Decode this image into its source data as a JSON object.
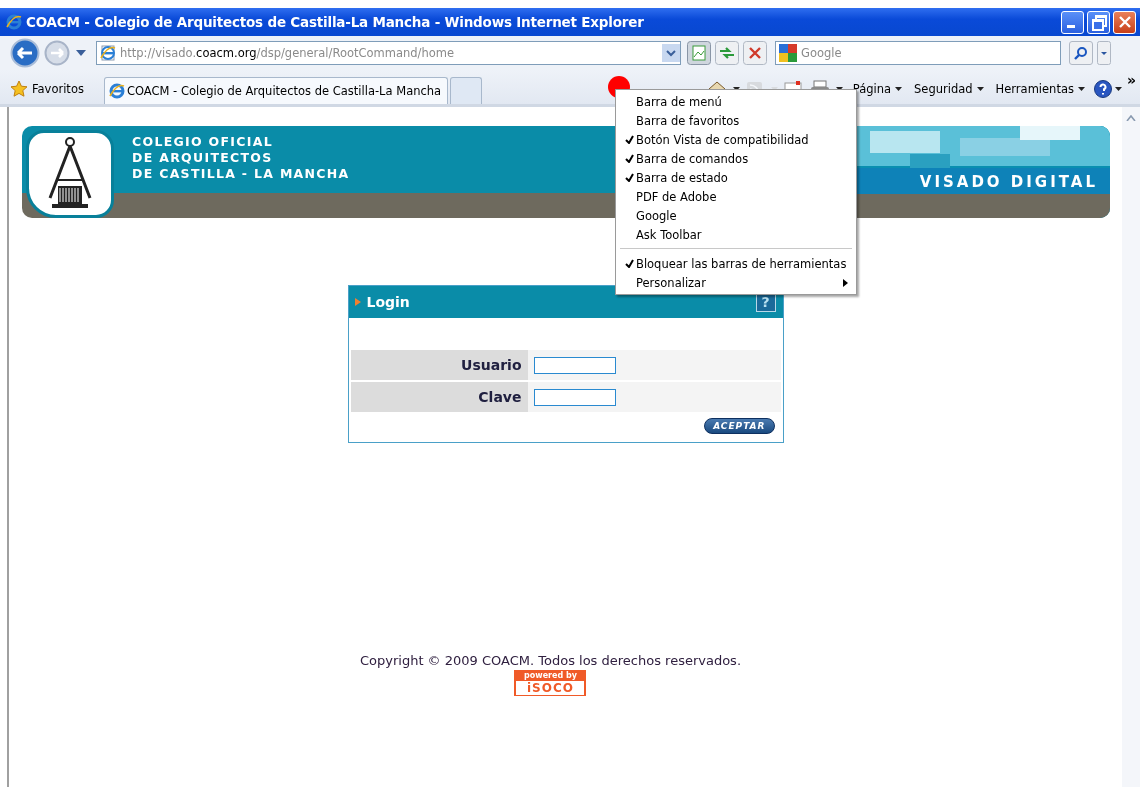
{
  "window": {
    "title": "COACM - Colegio de Arquitectos de Castilla-La Mancha - Windows Internet Explorer"
  },
  "address_bar": {
    "parts": [
      {
        "text": "http://visado.",
        "kind": "dim"
      },
      {
        "text": "coacm.org",
        "kind": "strong"
      },
      {
        "text": "/dsp/general/RootCommand/home",
        "kind": "dim"
      }
    ]
  },
  "search": {
    "placeholder": "Google"
  },
  "favorites": {
    "label": "Favoritos"
  },
  "tabs": [
    {
      "label": "COACM - Colegio de Arquitectos de Castilla-La Mancha",
      "selected": true
    },
    {
      "selected": false
    }
  ],
  "command_bar": {
    "items": [
      {
        "kind": "home"
      },
      {
        "kind": "feeds",
        "disabled": true
      },
      {
        "kind": "mail"
      },
      {
        "kind": "print"
      },
      {
        "kind": "menu",
        "label": "Página"
      },
      {
        "kind": "menu",
        "label": "Seguridad"
      },
      {
        "kind": "menu",
        "label": "Herramientas"
      },
      {
        "kind": "help"
      }
    ],
    "overflow": "»"
  },
  "context_menu": {
    "items": [
      {
        "kind": "item",
        "label": "Barra de menú",
        "checked": false
      },
      {
        "kind": "item",
        "label": "Barra de favoritos",
        "checked": false
      },
      {
        "kind": "item",
        "label": "Botón Vista de compatibilidad",
        "checked": true
      },
      {
        "kind": "item",
        "label": "Barra de comandos",
        "checked": true
      },
      {
        "kind": "item",
        "label": "Barra de estado",
        "checked": true
      },
      {
        "kind": "item",
        "label": "PDF de Adobe",
        "checked": false
      },
      {
        "kind": "item",
        "label": "Google",
        "checked": false
      },
      {
        "kind": "item",
        "label": "Ask Toolbar",
        "checked": false
      },
      {
        "kind": "separator"
      },
      {
        "kind": "item",
        "label": "Bloquear las barras de herramientas",
        "checked": true
      },
      {
        "kind": "submenu",
        "label": "Personalizar",
        "checked": false
      }
    ]
  },
  "banner": {
    "org_lines": [
      "COLEGIO OFICIAL",
      "DE ARQUITECTOS",
      "DE CASTILLA - LA MANCHA"
    ],
    "service": "VISADO DIGITAL"
  },
  "login": {
    "title": "Login",
    "help": "?",
    "fields": [
      {
        "label": "Usuario"
      },
      {
        "label": "Clave"
      }
    ],
    "submit": "ACEPTAR"
  },
  "footer": {
    "copyright": "Copyright © 2009 COACM. Todos los derechos reservados.",
    "badge_top": "powered by",
    "badge_bottom": "iSOCO"
  }
}
